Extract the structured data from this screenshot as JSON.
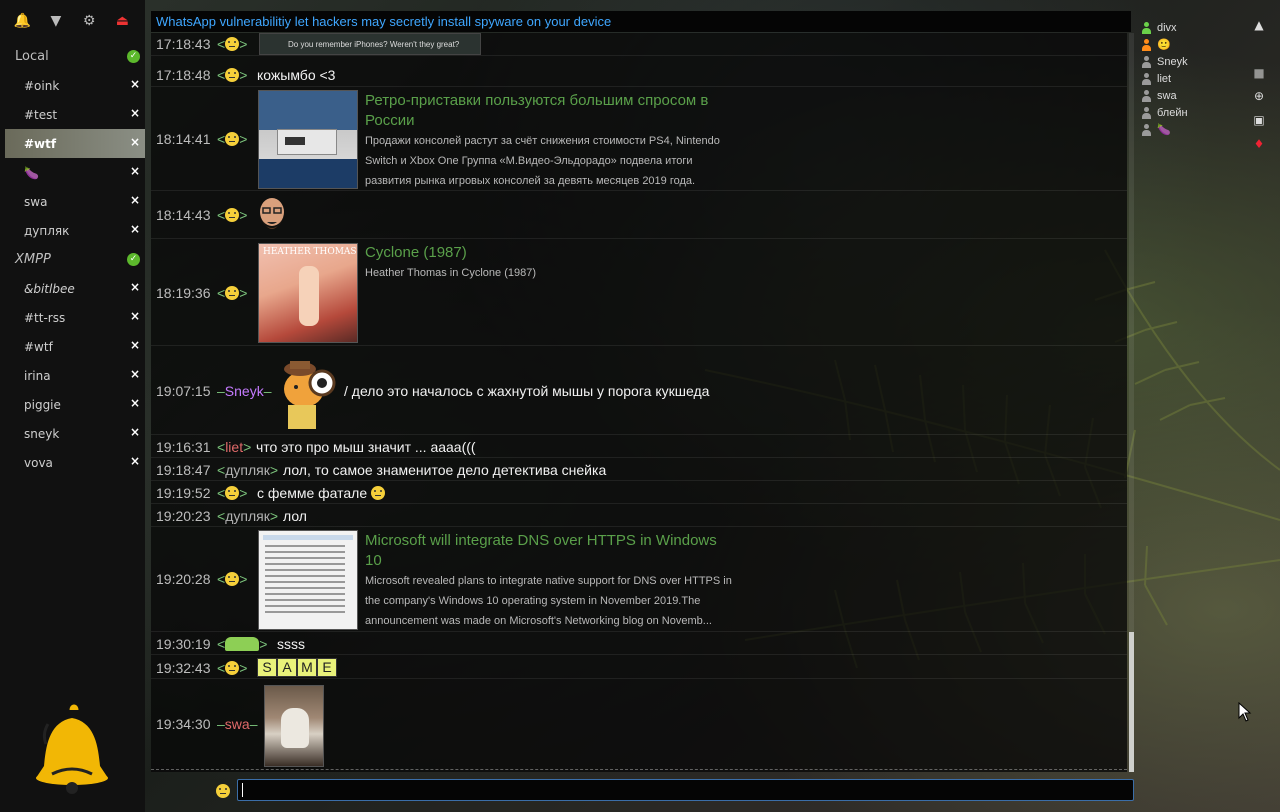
{
  "sidebar": {
    "toolbar": [
      {
        "icon": "bell-icon",
        "glyph": "🔔"
      },
      {
        "icon": "filter-icon",
        "glyph": "▼"
      },
      {
        "icon": "gear-icon",
        "glyph": "⚙"
      },
      {
        "icon": "logout-icon",
        "glyph": "⏏"
      }
    ],
    "local": {
      "label": "Local"
    },
    "local_channels": [
      "#oink",
      "#test",
      "#wtf",
      "🍆",
      "swa",
      "дупляк"
    ],
    "xmpp": {
      "label": "XMPP"
    },
    "xmpp_channels": [
      "&bitlbee",
      "#tt-rss",
      "#wtf",
      "irina",
      "piggie",
      "sneyk",
      "vova"
    ],
    "close_glyph": "×",
    "ok_glyph": "✓"
  },
  "topic": "WhatsApp vulnerabilitiy let hackers may secretly install spyware on your device",
  "messages": [
    {
      "ts": "17:18:43",
      "nick_left": "<",
      "nick_right": ">",
      "image_caption": "Do you remember iPhones? Weren't they great?"
    },
    {
      "ts": "17:18:48",
      "nick_left": "<",
      "nick_right": ">",
      "text": "кожымбо <3"
    },
    {
      "ts": "18:14:41",
      "nick_left": "<",
      "nick_right": ">",
      "card_title": "Ретро-приставки пользуются большим спросом в России",
      "card_desc": "Продажи консолей растут за счёт снижения стоимости PS4, Nintendo Switch и Xbox One Группа «М.Видео-Эльдорадо» подвела итоги развития рынка игровых консолей за девять месяцев 2019 года."
    },
    {
      "ts": "18:14:43",
      "nick_left": "<",
      "nick_right": ">"
    },
    {
      "ts": "18:19:36",
      "nick_left": "<",
      "nick_right": ">",
      "card_title": "Cyclone (1987)",
      "card_desc": "Heather Thomas in Cyclone (1987)",
      "poster_title": "HEATHER THOMAS"
    },
    {
      "ts": "19:07:15",
      "nick_left": "–",
      "nick": "Sneyk",
      "nick_right": "–",
      "text": "/ дело это началось с жахнутой мышы у порога кукшеда"
    },
    {
      "ts": "19:16:31",
      "nick_left": "<",
      "nick": "liet",
      "nick_right": ">",
      "text": "что это про мыш значит ... аааа((("
    },
    {
      "ts": "19:18:47",
      "nick_left": "<",
      "nick": "дупляк",
      "nick_right": ">",
      "text": "лол, то самое знаменитое дело детектива снейка"
    },
    {
      "ts": "19:19:52",
      "nick_left": "<",
      "nick_right": ">",
      "text": "с фемме фатале"
    },
    {
      "ts": "19:20:23",
      "nick_left": "<",
      "nick": "дупляк",
      "nick_right": ">",
      "text": "лол"
    },
    {
      "ts": "19:20:28",
      "nick_left": "<",
      "nick_right": ">",
      "card_title": "Microsoft will integrate DNS over HTTPS in Windows 10",
      "card_desc": "Microsoft revealed plans to integrate native support for DNS over HTTPS in the company's Windows 10 operating system in November 2019.The announcement was made on Microsoft's Networking blog on Novemb..."
    },
    {
      "ts": "19:30:19",
      "nick_left": "<",
      "nick_right": ">",
      "text": "ssss"
    },
    {
      "ts": "19:32:43",
      "nick_left": "<",
      "nick_right": ">",
      "letters": [
        "S",
        "A",
        "M",
        "E"
      ]
    },
    {
      "ts": "19:34:30",
      "nick_left": "–",
      "nick": "swa",
      "nick_right": "–"
    }
  ],
  "users": [
    {
      "name": "divx",
      "color": "#6bd14a"
    },
    {
      "name": "🙂",
      "color": "#ff8c1a"
    },
    {
      "name": "Sneyk",
      "color": "#9a9a9a"
    },
    {
      "name": "liet",
      "color": "#9a9a9a"
    },
    {
      "name": "swa",
      "color": "#9a9a9a"
    },
    {
      "name": "блейн",
      "color": "#9a9a9a"
    },
    {
      "name": "🍆",
      "color": "#9a9a9a"
    }
  ],
  "input": {
    "value": ""
  }
}
